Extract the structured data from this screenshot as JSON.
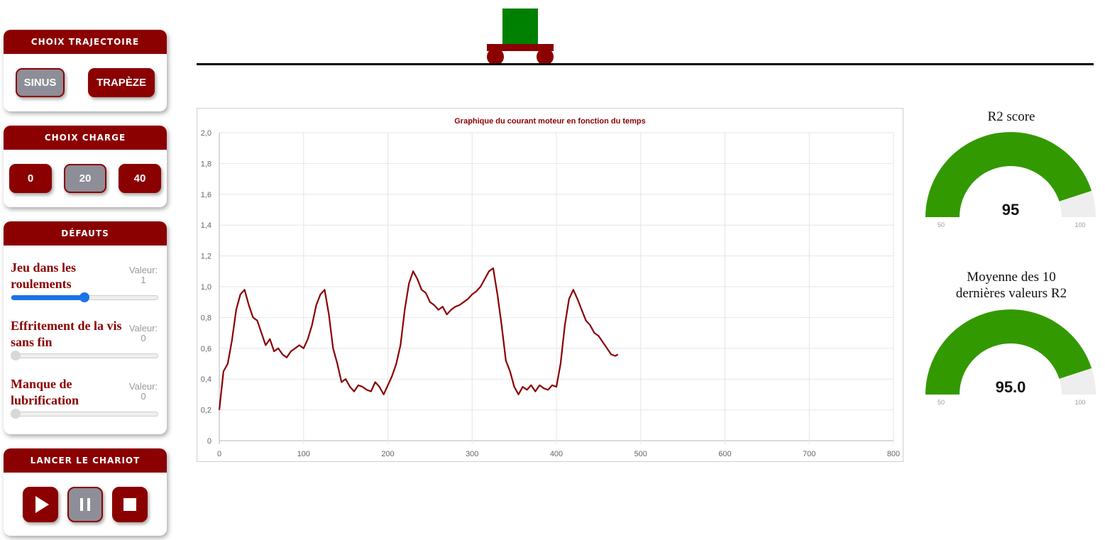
{
  "colors": {
    "accent": "#8b0000",
    "active_button": "#8e8e98",
    "cart_box": "#008000",
    "gauge_fill": "#339900",
    "gauge_rest": "#eeeeee",
    "slider_blue": "#1a73e8"
  },
  "trajectory": {
    "title": "CHOIX TRAJECTOIRE",
    "options": [
      "SINUS",
      "TRAPÈZE"
    ],
    "selected": "SINUS"
  },
  "charge": {
    "title": "CHOIX CHARGE",
    "options": [
      "0",
      "20",
      "40"
    ],
    "selected": "20"
  },
  "defects": {
    "title": "DÉFAUTS",
    "items": [
      {
        "label": "Jeu dans les roulements",
        "value_label": "Valeur:",
        "value": "1",
        "slider_fraction": 0.5
      },
      {
        "label": "Effritement de la vis sans fin",
        "value_label": "Valeur:",
        "value": "0",
        "slider_fraction": 0
      },
      {
        "label": "Manque de lubrification",
        "value_label": "Valeur:",
        "value": "0",
        "slider_fraction": 0
      }
    ]
  },
  "launch": {
    "title": "LANCER LE CHARIOT",
    "buttons": [
      "play-icon",
      "pause-icon",
      "stop-icon"
    ],
    "active": "pause-icon"
  },
  "gauges": [
    {
      "title": "R2 score",
      "value": "95",
      "min": "50",
      "max": "100",
      "fraction": 0.9
    },
    {
      "title": "Moyenne des 10 dernières valeurs R2",
      "value": "95.0",
      "min": "50",
      "max": "100",
      "fraction": 0.9
    }
  ],
  "chart_data": {
    "type": "line",
    "title": "Graphique du courant moteur en fonction du temps",
    "xlabel": "",
    "ylabel": "",
    "xlim": [
      0,
      800
    ],
    "ylim": [
      0,
      2
    ],
    "x_ticks": [
      "0",
      "100",
      "200",
      "300",
      "400",
      "500",
      "600",
      "700",
      "800"
    ],
    "y_ticks": [
      "0",
      "0,2",
      "0,4",
      "0,6",
      "0,8",
      "1,0",
      "1,2",
      "1,4",
      "1,6",
      "1,8",
      "2,0"
    ],
    "grid": true,
    "line_color": "#8b0000",
    "series": [
      {
        "x": [
          0,
          5,
          10,
          15,
          20,
          25,
          30,
          35,
          40,
          45,
          50,
          55,
          60,
          65,
          70,
          75,
          80,
          85,
          90,
          95,
          100,
          105,
          110,
          115,
          120,
          125,
          130,
          135,
          140,
          145,
          150,
          155,
          160,
          165,
          170,
          175,
          180,
          185,
          190,
          195,
          200,
          205,
          210,
          215,
          220,
          225,
          230,
          235,
          240,
          245,
          250,
          255,
          260,
          265,
          270,
          275,
          280,
          285,
          290,
          295,
          300,
          305,
          310,
          315,
          320,
          325,
          330,
          335,
          340,
          345,
          350,
          355,
          360,
          365,
          370,
          375,
          380,
          385,
          390,
          395,
          400,
          405,
          410,
          415,
          420,
          425,
          430,
          435,
          440,
          445,
          450,
          455,
          460,
          465,
          470,
          473
        ],
        "y": [
          0.2,
          0.45,
          0.5,
          0.65,
          0.85,
          0.95,
          0.98,
          0.88,
          0.8,
          0.78,
          0.7,
          0.62,
          0.66,
          0.58,
          0.6,
          0.56,
          0.54,
          0.58,
          0.6,
          0.62,
          0.6,
          0.66,
          0.75,
          0.88,
          0.95,
          0.98,
          0.82,
          0.6,
          0.5,
          0.38,
          0.4,
          0.35,
          0.32,
          0.36,
          0.35,
          0.33,
          0.32,
          0.38,
          0.35,
          0.3,
          0.36,
          0.42,
          0.5,
          0.62,
          0.85,
          1.02,
          1.1,
          1.05,
          0.98,
          0.96,
          0.9,
          0.88,
          0.85,
          0.87,
          0.82,
          0.85,
          0.87,
          0.88,
          0.9,
          0.92,
          0.95,
          0.97,
          1.0,
          1.05,
          1.1,
          1.12,
          0.95,
          0.75,
          0.52,
          0.45,
          0.35,
          0.3,
          0.35,
          0.33,
          0.36,
          0.32,
          0.36,
          0.34,
          0.33,
          0.36,
          0.35,
          0.5,
          0.75,
          0.92,
          0.98,
          0.92,
          0.85,
          0.78,
          0.75,
          0.7,
          0.68,
          0.64,
          0.6,
          0.56,
          0.55,
          0.56
        ]
      }
    ]
  }
}
